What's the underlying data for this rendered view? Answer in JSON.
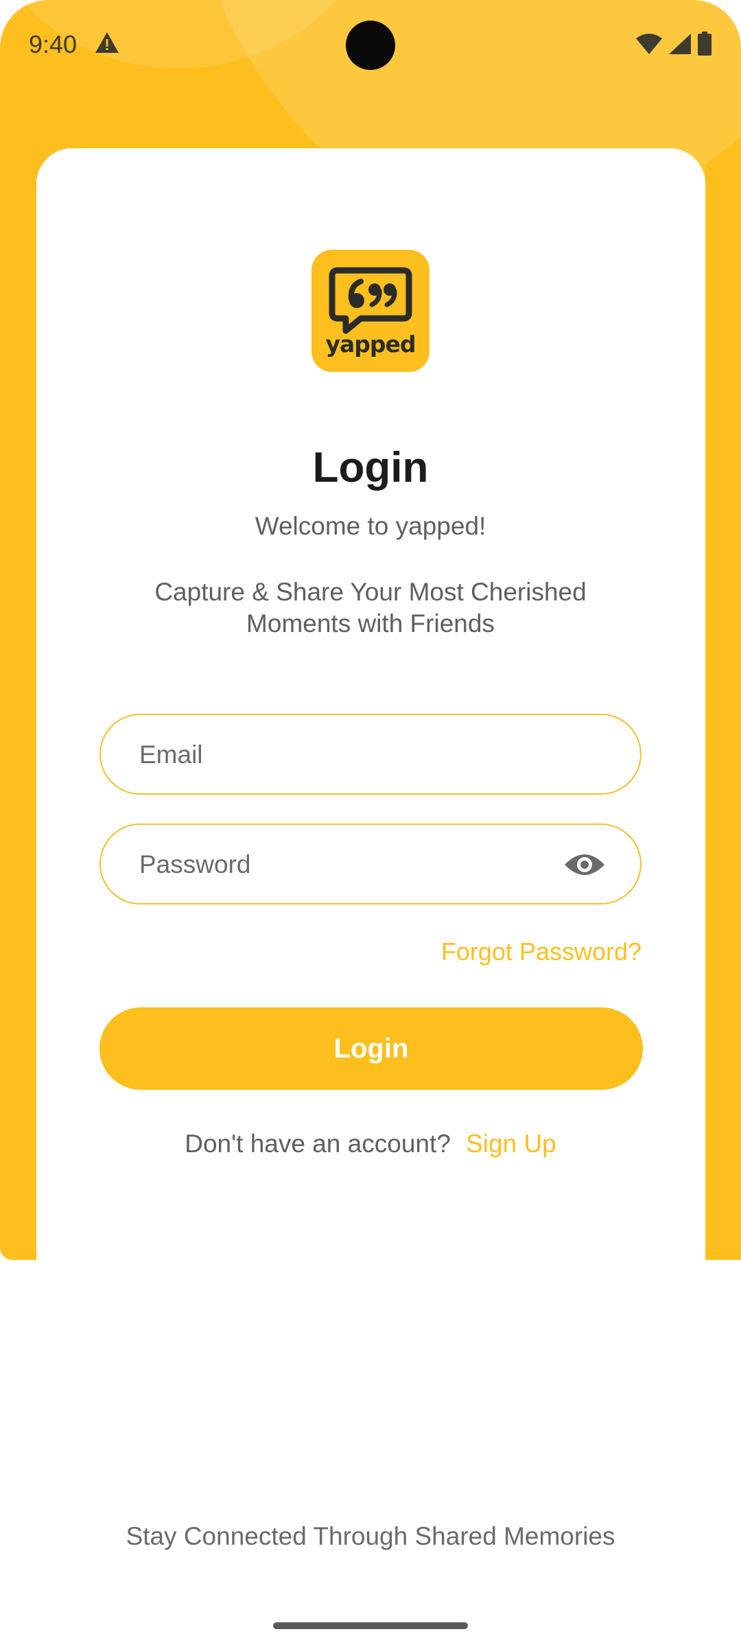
{
  "status_bar": {
    "time": "9:40",
    "icons": [
      "warning-icon",
      "wifi-icon",
      "signal-icon",
      "battery-icon"
    ]
  },
  "logo": {
    "text": "yapped",
    "icon": "quote-bubble-icon"
  },
  "header": {
    "title": "Login",
    "welcome": "Welcome to yapped!",
    "tagline": "Capture & Share Your Most Cherished Moments with Friends"
  },
  "form": {
    "email_placeholder": "Email",
    "email_value": "",
    "password_placeholder": "Password",
    "password_value": "",
    "forgot_label": "Forgot Password?",
    "login_label": "Login"
  },
  "signup": {
    "prompt": "Don't have an account?",
    "link_label": "Sign Up"
  },
  "footer": {
    "text": "Stay Connected Through Shared Memories"
  },
  "colors": {
    "accent": "#FDBF1E",
    "text_dark": "#1c1c1c",
    "text_muted": "#5f5f5f"
  }
}
